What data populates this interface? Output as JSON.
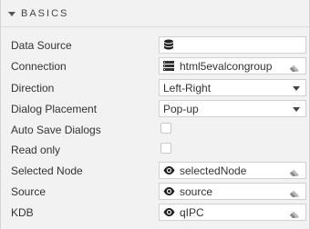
{
  "section": {
    "title": "BASICS"
  },
  "fields": {
    "data_source": {
      "label": "Data Source",
      "value": ""
    },
    "connection": {
      "label": "Connection",
      "value": "html5evalcongroup"
    },
    "direction": {
      "label": "Direction",
      "value": "Left-Right"
    },
    "dialog_placement": {
      "label": "Dialog Placement",
      "value": "Pop-up"
    },
    "auto_save_dialogs": {
      "label": "Auto Save Dialogs",
      "checked": false
    },
    "read_only": {
      "label": "Read only",
      "checked": false
    },
    "selected_node": {
      "label": "Selected Node",
      "value": "selectedNode"
    },
    "source": {
      "label": "Source",
      "value": "source"
    },
    "kdb": {
      "label": "KDB",
      "value": "qIPC"
    }
  },
  "icons": {
    "section_toggle": "caret-down-icon",
    "data_source": "database-icon",
    "connection": "server-icon",
    "view_state": "eye-icon",
    "clear": "eraser-icon",
    "select": "chevron-down-icon"
  }
}
